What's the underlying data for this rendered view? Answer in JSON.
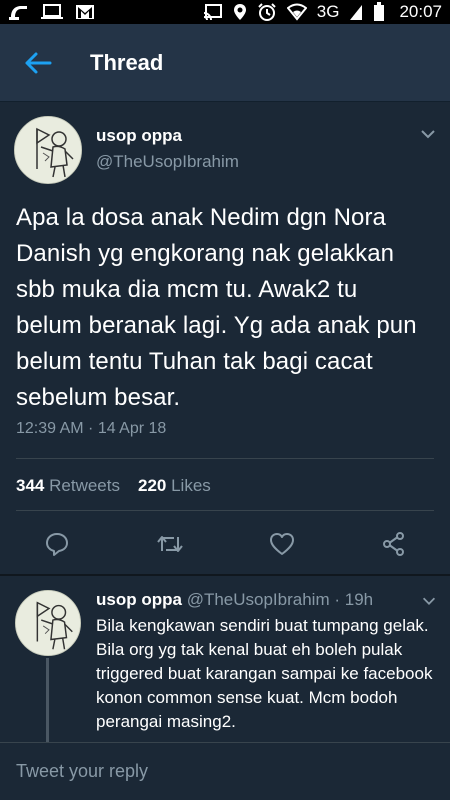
{
  "status_bar": {
    "time": "20:07",
    "network": "3G",
    "left_icons": [
      "notification-icon",
      "laptop-icon",
      "gmail-icon"
    ],
    "right_icons": [
      "cast-icon",
      "location-icon",
      "alarm-icon",
      "wifi-icon",
      "signal-icon",
      "battery-icon"
    ]
  },
  "header": {
    "title": "Thread",
    "back_icon": "arrow-left-icon"
  },
  "tweet": {
    "author_name": "usop oppa",
    "author_handle": "@TheUsopIbrahim",
    "text": "Apa la dosa anak Nedim dgn Nora Danish yg engkorang nak gelakkan sbb muka dia mcm tu. Awak2 tu belum beranak lagi. Yg ada anak pun belum tentu Tuhan tak bagi cacat sebelum besar.",
    "timestamp": "12:39 AM · 14 Apr 18",
    "retweets_count": "344",
    "retweets_label": "Retweets",
    "likes_count": "220",
    "likes_label": "Likes",
    "actions": [
      "reply-icon",
      "retweet-icon",
      "like-icon",
      "share-icon"
    ]
  },
  "reply": {
    "author_name": "usop oppa",
    "author_handle": "@TheUsopIbrahim",
    "age": "· 19h",
    "text": "Bila kengkawan sendiri buat tumpang gelak. Bila org yg tak kenal buat eh boleh pulak triggered buat karangan sampai ke facebook konon common sense kuat. Mcm bodoh perangai masing2."
  },
  "composer": {
    "placeholder": "Tweet your reply"
  },
  "colors": {
    "background": "#1b2836",
    "app_bar": "#243447",
    "accent": "#1da1f2",
    "secondary_text": "#8899a6",
    "divider": "#38444d"
  }
}
